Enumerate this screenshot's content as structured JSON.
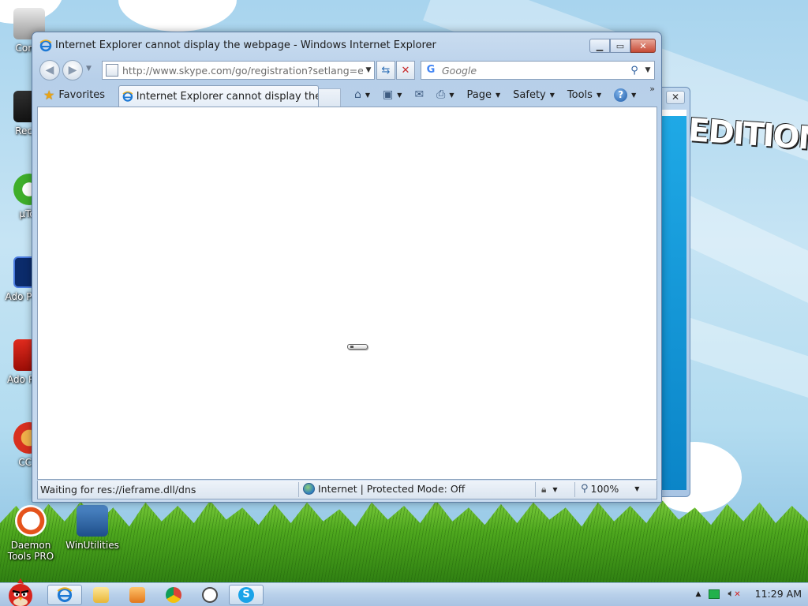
{
  "window": {
    "title": "Internet Explorer cannot display the webpage - Windows Internet Explorer",
    "minimize_icon": "minimize-icon",
    "maximize_icon": "maximize-icon",
    "close_icon": "close-icon"
  },
  "navigation": {
    "address_url": "http://www.skype.com/go/registration?setlang=en&",
    "search_placeholder": "Google",
    "search_provider_icon": "google-icon"
  },
  "command_bar": {
    "favorites_label": "Favorites",
    "tab_title": "Internet Explorer cannot display the ...",
    "page_label": "Page",
    "safety_label": "Safety",
    "tools_label": "Tools"
  },
  "status_bar": {
    "status_text": "Waiting for res://ieframe.dll/dns",
    "zone_text": "Internet | Protected Mode: Off",
    "zoom_level": "100%"
  },
  "desktop": {
    "icons": [
      {
        "label": "Comp",
        "icon": "computer-icon"
      },
      {
        "label": "Recyc",
        "icon": "recycle-bin-icon"
      },
      {
        "label": "µTor",
        "icon": "utorrent-icon"
      },
      {
        "label": "Ado Photo",
        "icon": "photoshop-icon"
      },
      {
        "label": "Ado Reac",
        "icon": "acrobat-reader-icon"
      },
      {
        "label": "CCle",
        "icon": "ccleaner-icon"
      },
      {
        "label": "Daemon Tools PRO",
        "icon": "daemon-tools-icon"
      },
      {
        "label": "WinUtilities",
        "icon": "winutilities-icon"
      }
    ],
    "wallpaper_text": "EDITION"
  },
  "taskbar": {
    "clock": "11:29 AM"
  },
  "colors": {
    "taskbar": "#b8d0ea",
    "close_button": "#c74a35",
    "stop_icon": "#c8282a",
    "network_tray": "#22b14c"
  }
}
